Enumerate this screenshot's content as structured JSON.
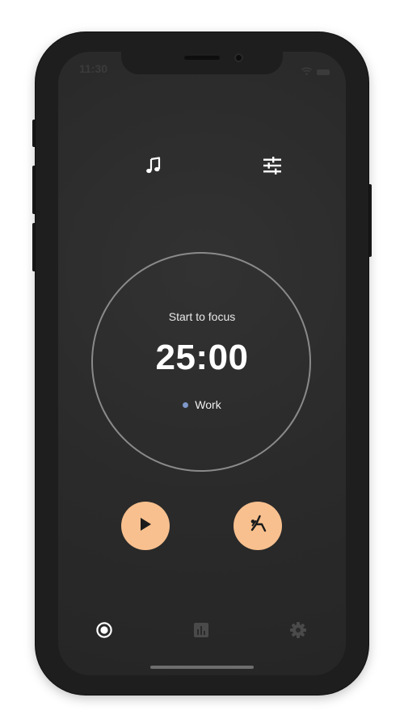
{
  "status_bar": {
    "time": "11:30"
  },
  "toolbar": {
    "music_icon": "music-note-icon",
    "tune_icon": "sliders-icon"
  },
  "timer": {
    "prompt": "Start to focus",
    "time": "25:00",
    "task": "Work",
    "task_color": "#7f97c9"
  },
  "actions": {
    "play_icon": "play-icon",
    "break_icon": "stretch-icon",
    "accent": "#f8c08e"
  },
  "tab_bar": {
    "items": [
      {
        "id": "timer",
        "icon": "record-icon",
        "active": true
      },
      {
        "id": "stats",
        "icon": "bar-chart-icon",
        "active": false
      },
      {
        "id": "settings",
        "icon": "gear-icon",
        "active": false
      }
    ],
    "active_color": "#ffffff",
    "inactive_color": "#4a4a4a"
  }
}
